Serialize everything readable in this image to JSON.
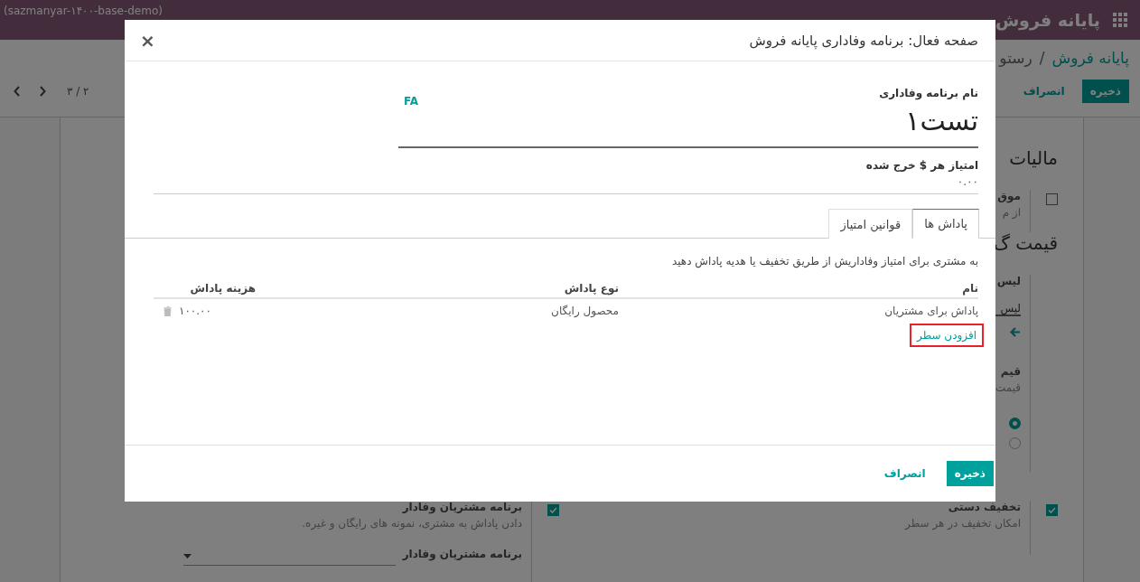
{
  "topbar": {
    "brand": "پایانه فروش",
    "database": "(sazmanyar-۱۴۰۰-base-demo)"
  },
  "breadcrumb": {
    "items": [
      "پایانه فروش",
      "رستو"
    ],
    "separator": "/"
  },
  "control_panel": {
    "buttons": [
      {
        "label": "ذخیره",
        "kind": "primary"
      },
      {
        "label": "انصراف",
        "kind": "link"
      }
    ],
    "pager": "۳ / ۲"
  },
  "settings_right": [
    {
      "kind": "heading",
      "text": "مالیات"
    },
    {
      "kind": "checkbox",
      "checked": false,
      "title": "موق",
      "description": "از م"
    },
    {
      "kind": "heading",
      "text": "قیمت گ"
    },
    {
      "kind": "field",
      "title": "لیس",
      "value": "لیس"
    },
    {
      "kind": "radios",
      "title": "قیم",
      "description": "قیمت",
      "options": [
        {
          "selected": true
        },
        {
          "selected": false
        }
      ]
    },
    {
      "kind": "checkbox",
      "checked": true,
      "title": "تخفیف دستی",
      "description": "امکان تخفیف در هر سطر"
    }
  ],
  "settings_left": [
    {
      "kind": "checkbox",
      "checked": true,
      "title": "برنامه مشتریان وفادار",
      "description": "دادن پاداش به مشتری، نمونه های رایگان و غیره.",
      "field_label": "برنامه مشتریان وفادار"
    }
  ],
  "dialog": {
    "title": "صفحه فعال: برنامه وفاداری پایانه فروش",
    "close": "×",
    "name_label": "نام برنامه وفاداری",
    "name": "تست۱",
    "language": "FA",
    "points_label": "امتیاز هر $ خرج شده",
    "points": "۰.۰۰",
    "tabs": [
      {
        "label": "پاداش ها",
        "selected": true
      },
      {
        "label": "قوانین امتیاز",
        "selected": false
      }
    ],
    "description": "به مشتری برای امتیاز وفاداریش از طریق تخفیف یا هدیه پاداش دهید",
    "columns": [
      "نام",
      "نوع پاداش",
      "هزینه پاداش"
    ],
    "rows": [
      {
        "cells": [
          "پاداش برای مشتریان",
          "محصول رایگان",
          "۱۰۰.۰۰"
        ]
      }
    ],
    "add_line": {
      "label": "افزودن سطر",
      "highlighted": true
    },
    "buttons": [
      {
        "label": "ذخیره",
        "kind": "primary"
      },
      {
        "label": "انصراف",
        "kind": "link"
      }
    ]
  }
}
